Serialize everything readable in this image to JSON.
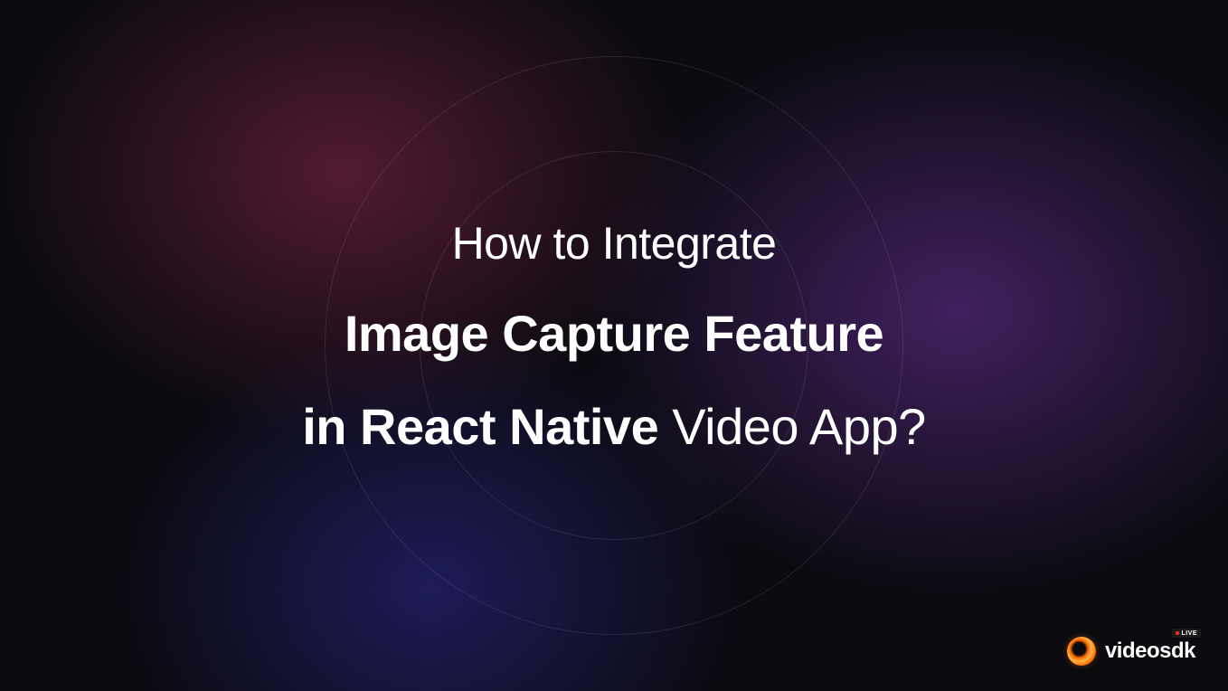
{
  "heading": {
    "line1": "How to Integrate",
    "line2": "Image Capture Feature",
    "line3_bold": "in React Native",
    "line3_light": " Video App?"
  },
  "brand": {
    "name": "videosdk",
    "badge": "LIVE"
  }
}
